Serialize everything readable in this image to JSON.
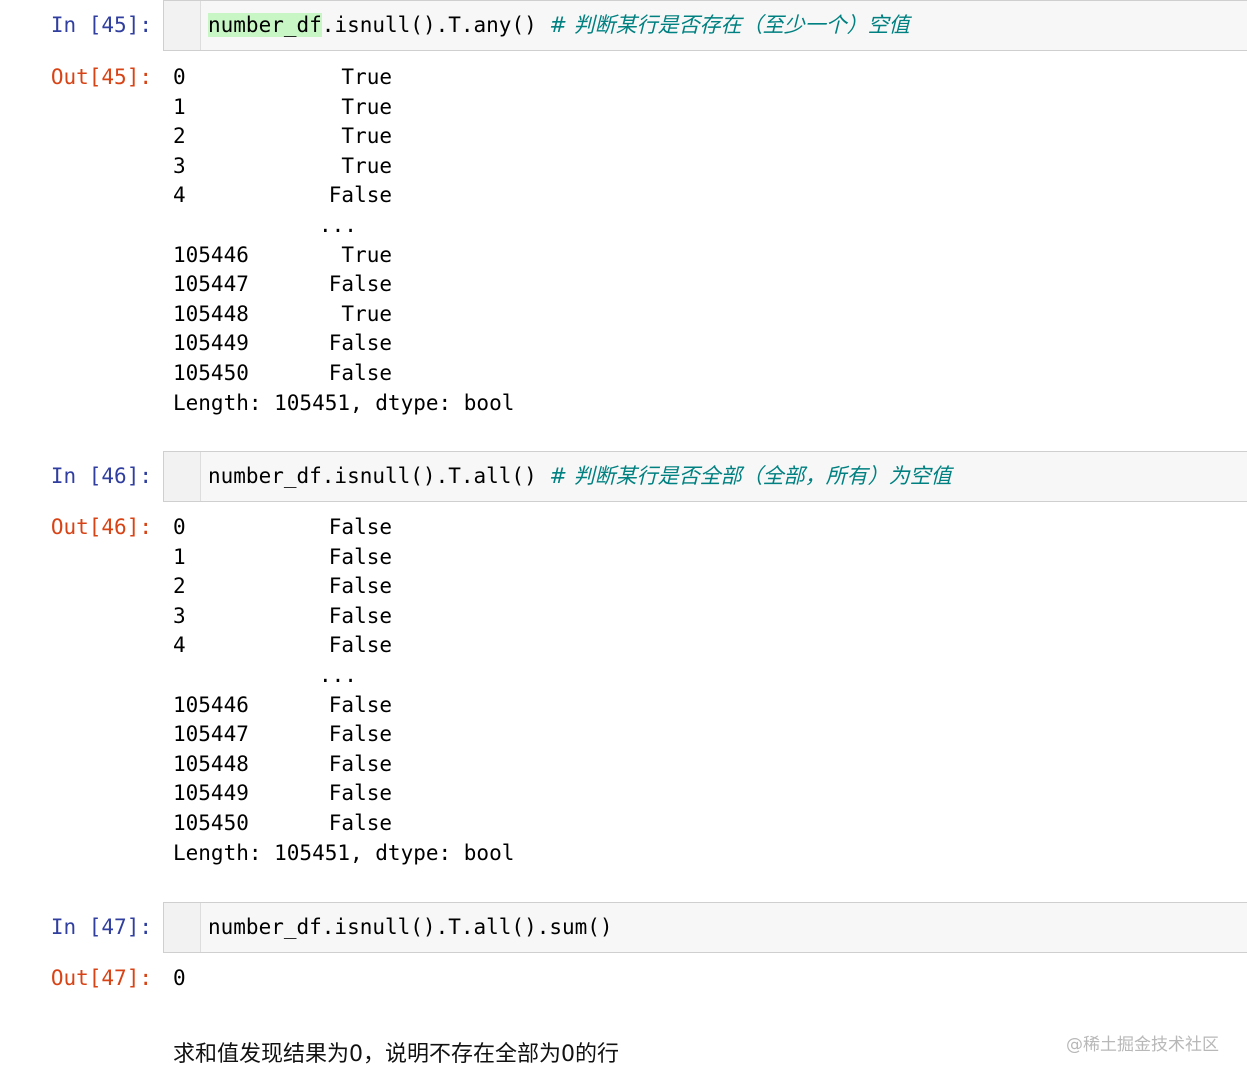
{
  "cells": [
    {
      "in_prompt": "In [45]:",
      "code_highlighted": "number_df",
      "code": ".isnull().T.any() ",
      "comment": "# 判断某行是否存在（至少一个）空值",
      "out_prompt": "Out[45]:",
      "rows": [
        {
          "index": "0",
          "value": "True"
        },
        {
          "index": "1",
          "value": "True"
        },
        {
          "index": "2",
          "value": "True"
        },
        {
          "index": "3",
          "value": "True"
        },
        {
          "index": "4",
          "value": "False"
        },
        {
          "index": "",
          "value": "..."
        },
        {
          "index": "105446",
          "value": "True"
        },
        {
          "index": "105447",
          "value": "False"
        },
        {
          "index": "105448",
          "value": "True"
        },
        {
          "index": "105449",
          "value": "False"
        },
        {
          "index": "105450",
          "value": "False"
        }
      ],
      "footer": "Length: 105451, dtype: bool"
    },
    {
      "in_prompt": "In [46]:",
      "code_highlighted": "",
      "code": "number_df.isnull().T.all() ",
      "comment": "# 判断某行是否全部（全部，所有）为空值",
      "out_prompt": "Out[46]:",
      "rows": [
        {
          "index": "0",
          "value": "False"
        },
        {
          "index": "1",
          "value": "False"
        },
        {
          "index": "2",
          "value": "False"
        },
        {
          "index": "3",
          "value": "False"
        },
        {
          "index": "4",
          "value": "False"
        },
        {
          "index": "",
          "value": "..."
        },
        {
          "index": "105446",
          "value": "False"
        },
        {
          "index": "105447",
          "value": "False"
        },
        {
          "index": "105448",
          "value": "False"
        },
        {
          "index": "105449",
          "value": "False"
        },
        {
          "index": "105450",
          "value": "False"
        }
      ],
      "footer": "Length: 105451, dtype: bool"
    },
    {
      "in_prompt": "In [47]:",
      "code_highlighted": "",
      "code": "number_df.isnull().T.all().sum()",
      "comment": "",
      "out_prompt": "Out[47]:",
      "result": "0"
    }
  ],
  "markdown_text": "求和值发现结果为0，说明不存在全部为0的行",
  "watermark": "@稀土掘金技术社区",
  "colors": {
    "in_prompt": "#303f9f",
    "out_prompt": "#d84315",
    "comment": "#008080",
    "highlight": "#c8f7c5",
    "input_bg": "#f7f7f7"
  }
}
